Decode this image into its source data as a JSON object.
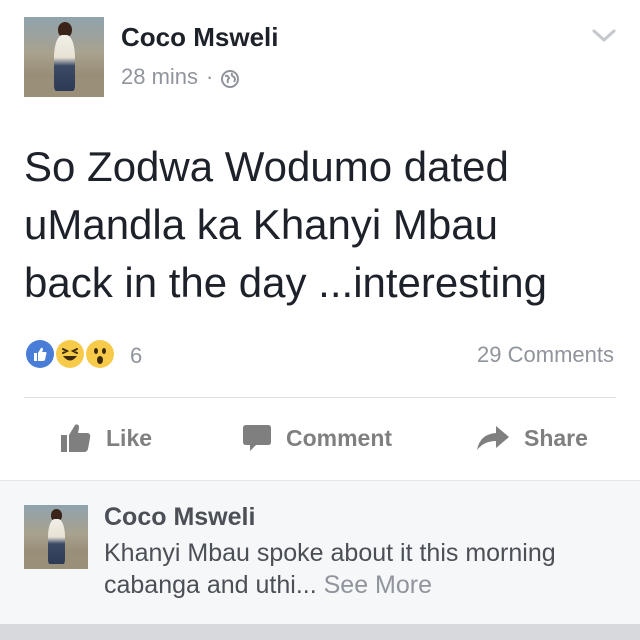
{
  "post": {
    "author": "Coco Msweli",
    "time": "28 mins",
    "separator": "·",
    "privacy_icon": "globe-icon",
    "text": "So Zodwa Wodumo dated\nuMandla ka Khanyi Mbau\nback in the day ...interesting",
    "reactions": {
      "icons": [
        "like-icon",
        "laugh-icon",
        "wow-icon"
      ],
      "count": "6"
    },
    "comments_count": "29 Comments",
    "actions": {
      "like": "Like",
      "comment": "Comment",
      "share": "Share"
    }
  },
  "comment_preview": {
    "author": "Coco Msweli",
    "text": "Khanyi Mbau spoke about it this morning cabanga and uthi...",
    "see_more": "See More"
  },
  "colors": {
    "text_primary": "#1d2129",
    "text_secondary": "#90949c",
    "action_gray": "#7f7f7f",
    "like_blue": "#4a7dd8",
    "reaction_yellow": "#f7ca4a",
    "comment_bg": "#f6f7f9"
  }
}
